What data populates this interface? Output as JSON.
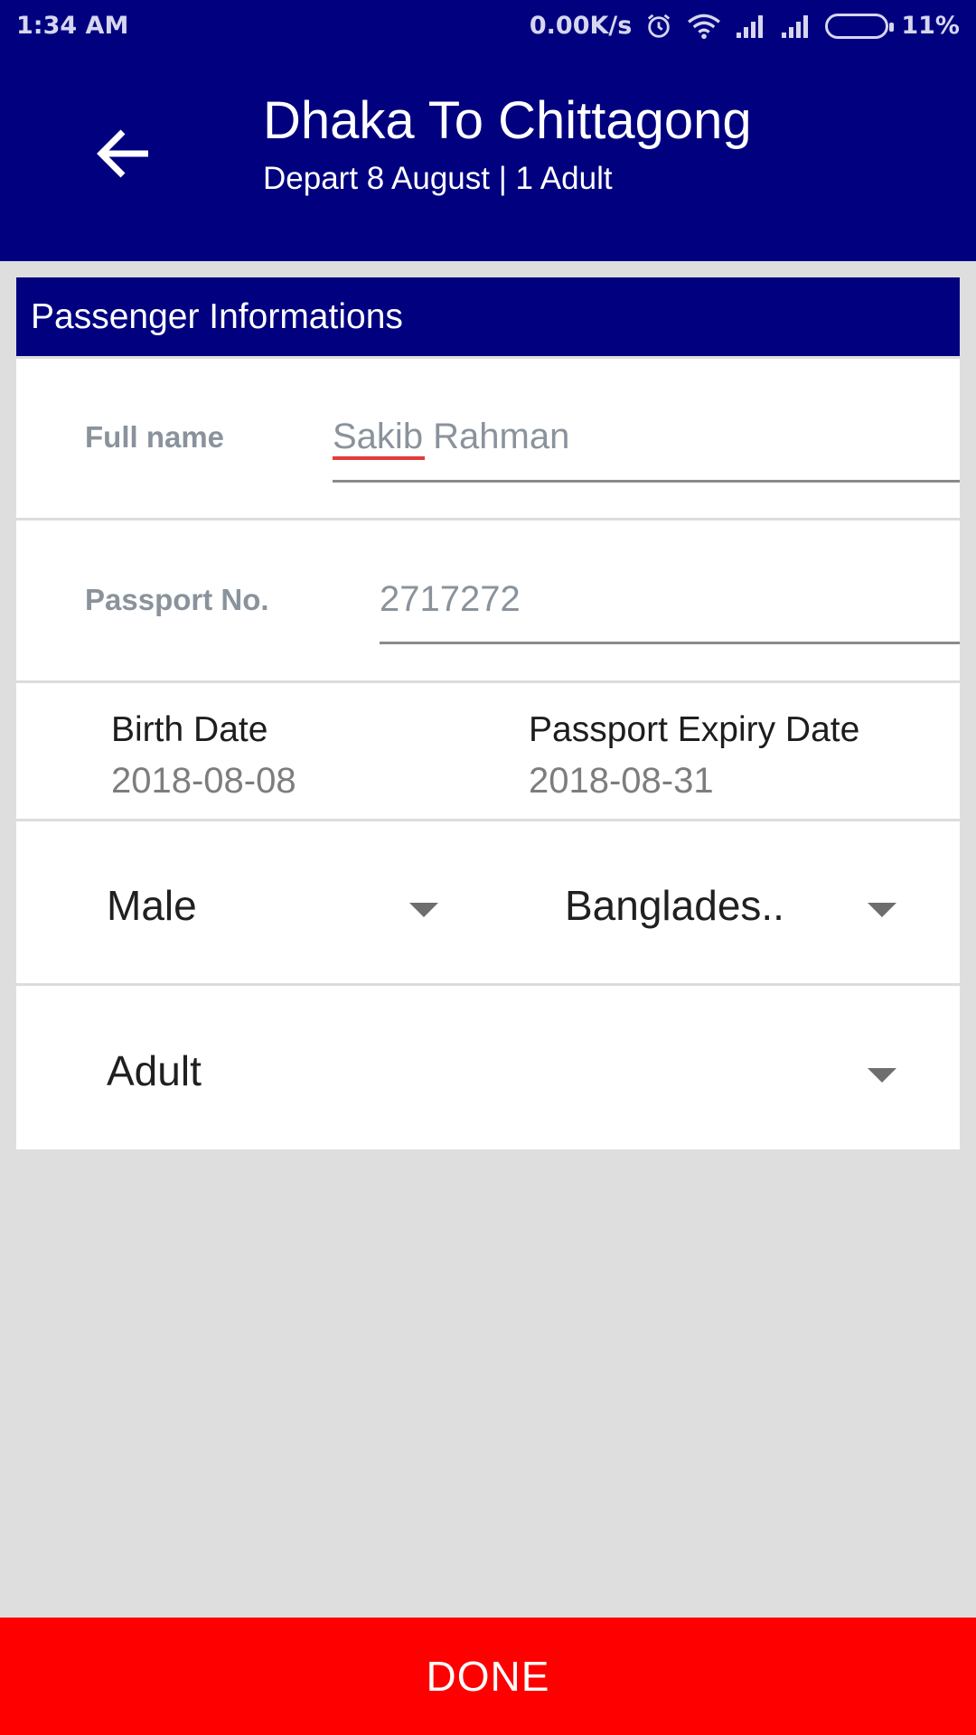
{
  "status_bar": {
    "time": "1:34 AM",
    "network_speed": "0.00K/s",
    "battery_percent": "11%",
    "icons": [
      "alarm-icon",
      "wifi-icon",
      "signal-icon",
      "signal-icon",
      "battery-icon"
    ]
  },
  "app_bar": {
    "title": "Dhaka To Chittagong",
    "subtitle": "Depart 8 August | 1 Adult",
    "back_icon": "arrow-left-icon"
  },
  "form": {
    "header": "Passenger Informations",
    "full_name": {
      "label": "Full name",
      "value": "Sakib Rahman"
    },
    "passport_no": {
      "label": "Passport No.",
      "value": "2717272"
    },
    "birth_date": {
      "label": "Birth Date",
      "value": "2018-08-08"
    },
    "passport_expiry": {
      "label": "Passport Expiry Date",
      "value": "2018-08-31"
    },
    "gender": {
      "selected": "Male"
    },
    "nationality": {
      "selected": "Banglades.."
    },
    "passenger_type": {
      "selected": "Adult"
    }
  },
  "actions": {
    "done_label": "DONE"
  },
  "colors": {
    "primary": "#010180",
    "accent": "#fe0000",
    "background": "#dedede"
  }
}
